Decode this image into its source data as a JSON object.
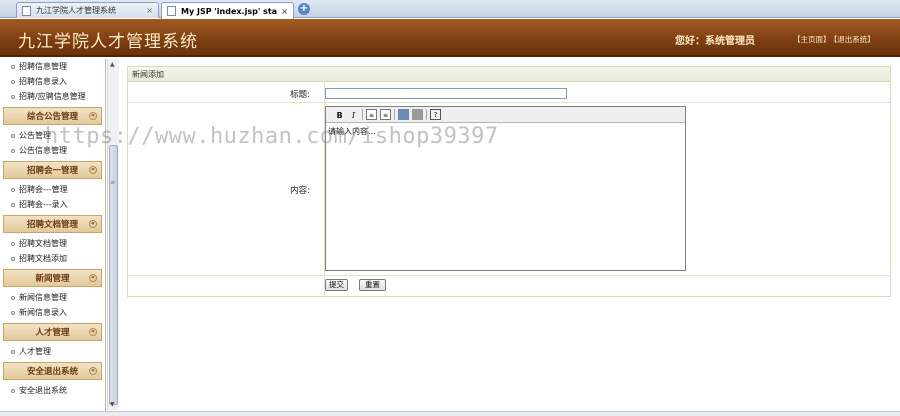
{
  "browser": {
    "tabs": [
      {
        "label": "九江学院人才管理系统",
        "active": false
      },
      {
        "label": "My JSP 'index.jsp' sta...",
        "active": true
      }
    ],
    "close_glyph": "×",
    "new_tab_glyph": "+"
  },
  "header": {
    "title": "九江学院人才管理系统",
    "greeting": "您好：系统管理员",
    "link_home": "【主页面】",
    "link_exit": "【退出系统】"
  },
  "sidebar": {
    "top_items": [
      "招聘信息管理",
      "招聘信息录入",
      "招聘/应聘信息管理"
    ],
    "sections": [
      {
        "title": "综合公告管理",
        "items": [
          "公告管理",
          "公告信息管理"
        ]
      },
      {
        "title": "招聘会一管理",
        "items": [
          "招聘会---管理",
          "招聘会---录入"
        ]
      },
      {
        "title": "招聘文档管理",
        "items": [
          "招聘文档管理",
          "招聘文档添加"
        ]
      },
      {
        "title": "新闻管理",
        "items": [
          "新闻信息管理",
          "新闻信息录入"
        ]
      },
      {
        "title": "人才管理",
        "items": [
          "人才管理"
        ]
      },
      {
        "title": "安全退出系统",
        "items": [
          "安全退出系统"
        ]
      }
    ],
    "collapse_glyph": "«"
  },
  "form": {
    "panel_title": "新闻添加",
    "title_label": "标题:",
    "title_value": "",
    "content_label": "内容:",
    "editor_placeholder": "请输入内容...",
    "toolbar": {
      "bold": "B",
      "italic": "I",
      "help": "?"
    },
    "submit_label": "提交",
    "reset_label": "重置"
  },
  "watermark": "https://www.huzhan.com/ishop39397",
  "scrollbar": {
    "up": "▲",
    "down": "▼",
    "grip": "≡"
  }
}
